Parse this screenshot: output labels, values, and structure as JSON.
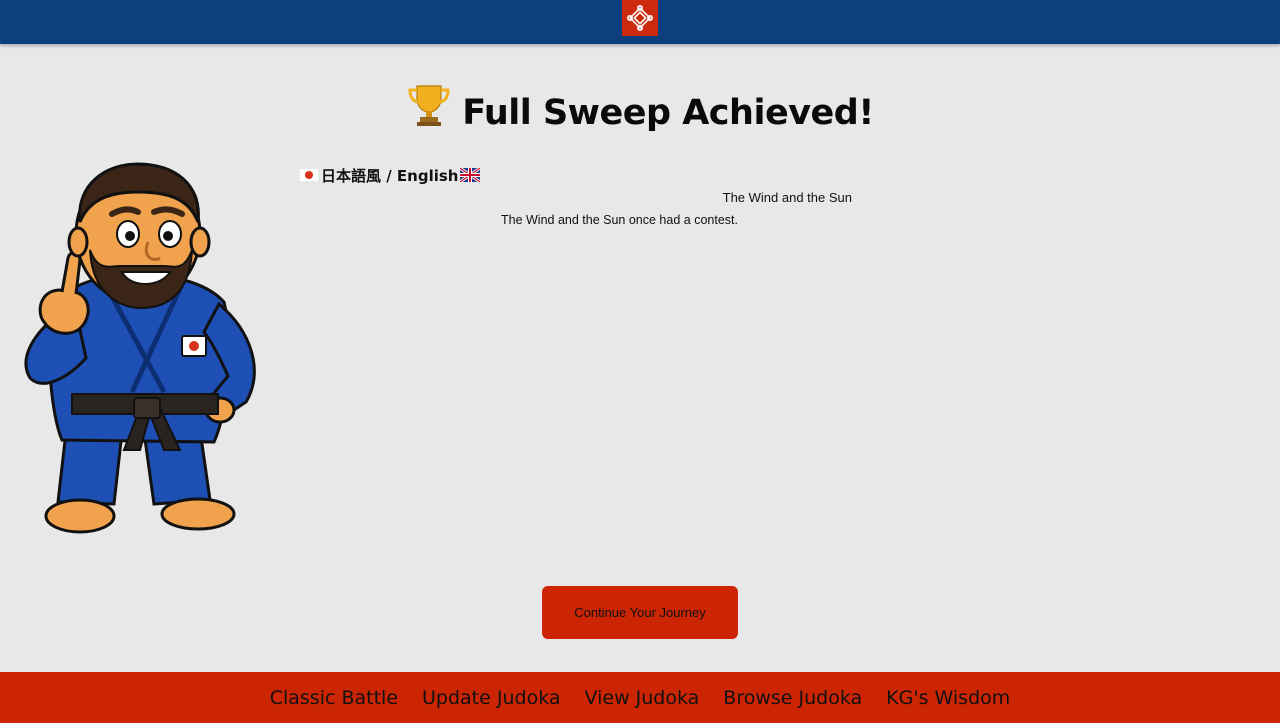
{
  "header": {
    "logo_icon": "knot-emblem-icon"
  },
  "page": {
    "title": "Full Sweep Achieved!",
    "title_icon": "trophy-icon"
  },
  "mascot": {
    "icon": "judoka-mascot"
  },
  "language_toggle": {
    "label": "日本語風 / English",
    "left_flag": "japan-flag-icon",
    "right_flag": "uk-flag-icon"
  },
  "story": {
    "title": "The Wind and the Sun",
    "body": "The Wind and the Sun once had a contest."
  },
  "continue_button": {
    "label": "Continue Your Journey"
  },
  "footer": {
    "links": [
      "Classic Battle",
      "Update Judoka",
      "View Judoka",
      "Browse Judoka",
      "KG's Wisdom"
    ]
  },
  "colors": {
    "header": "#0c3f7e",
    "accent": "#cb2504",
    "background": "#e8e8e8"
  }
}
